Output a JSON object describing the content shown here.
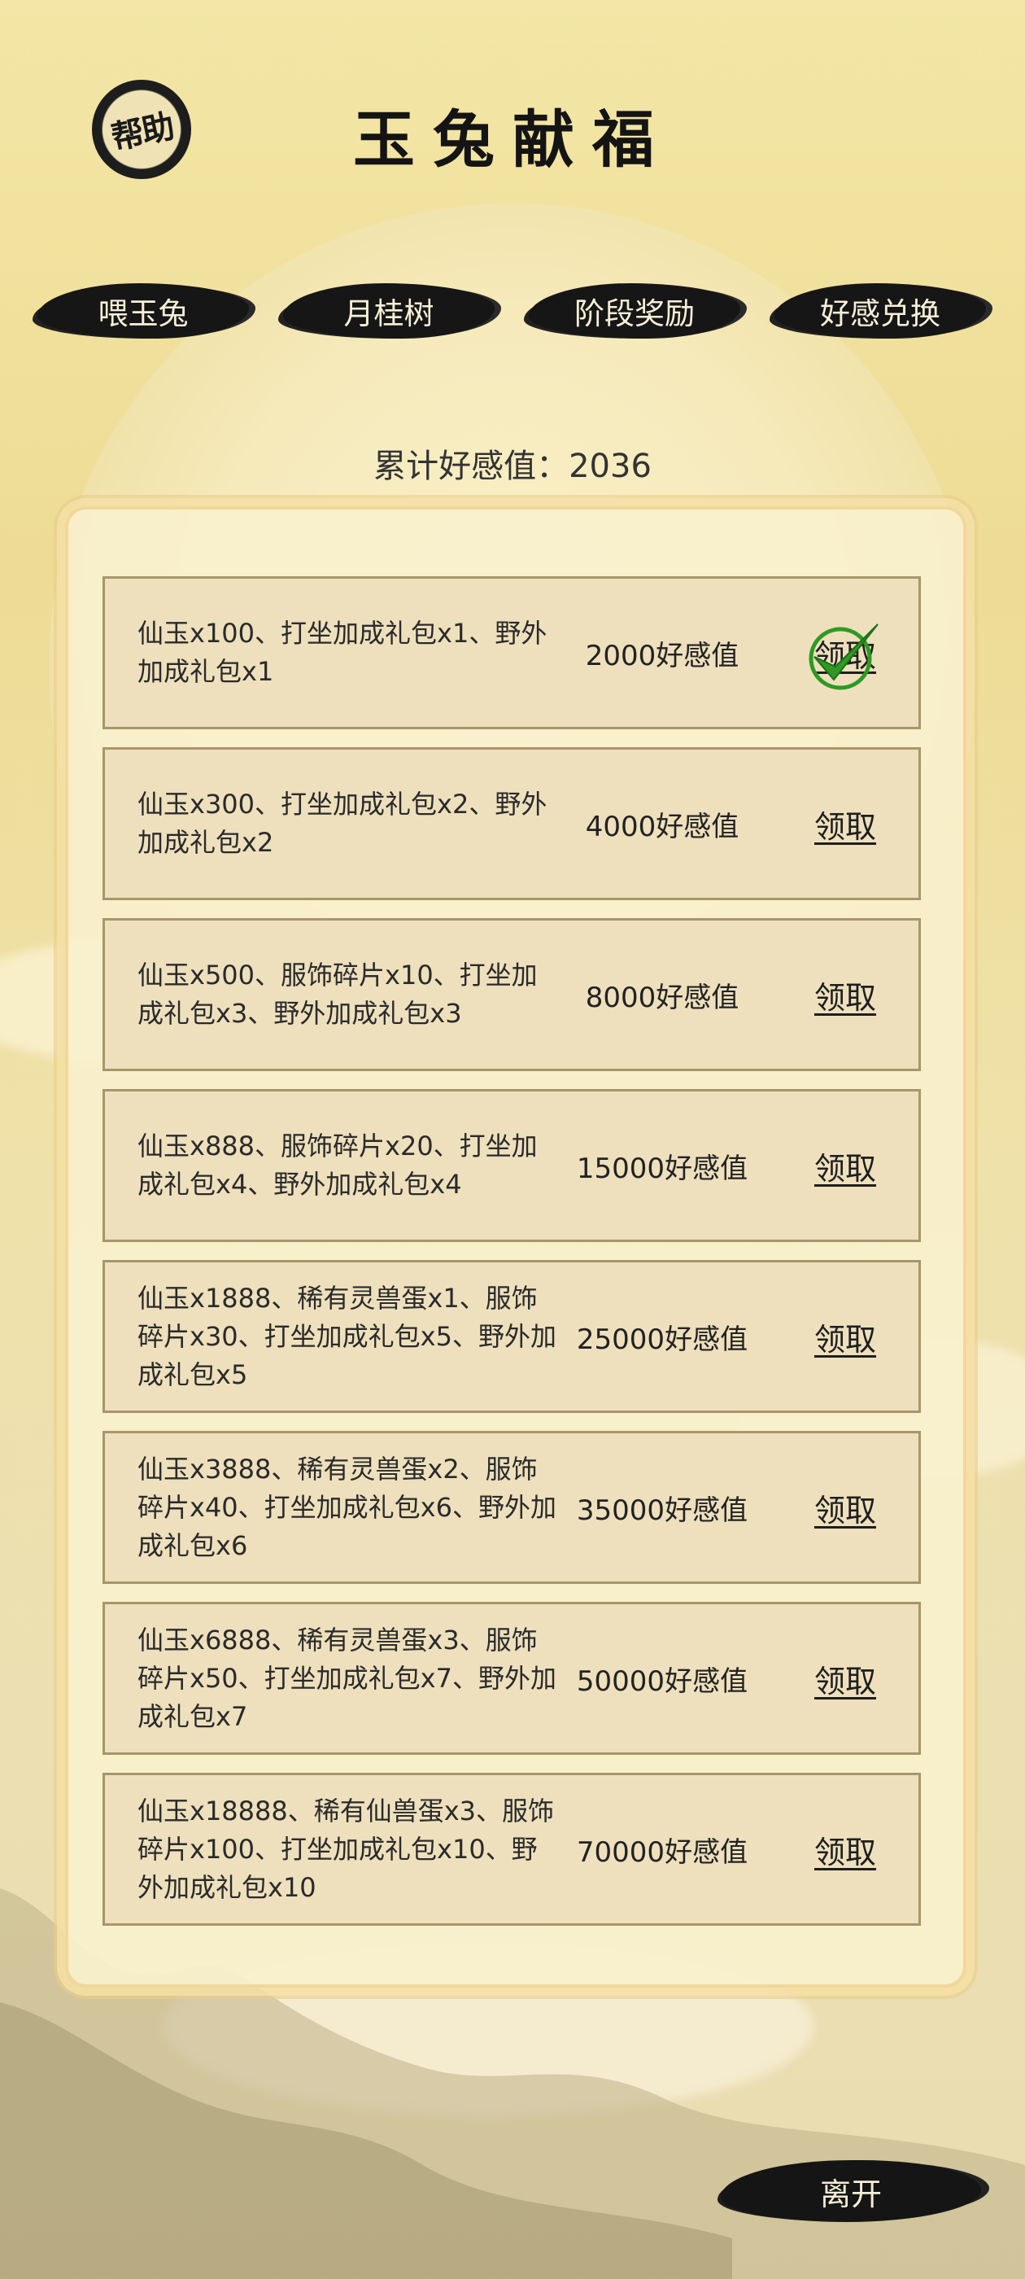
{
  "header": {
    "help_label": "帮助",
    "title": "玉兔献福"
  },
  "tabs": [
    {
      "label": "喂玉兔"
    },
    {
      "label": "月桂树"
    },
    {
      "label": "阶段奖励"
    },
    {
      "label": "好感兑换"
    }
  ],
  "total_favor": "累计好感值：2036",
  "rows": [
    {
      "reward": "仙玉x100、打坐加成礼包x1、野外加成礼包x1",
      "required": "2000好感值",
      "action": "领取",
      "claimed": true
    },
    {
      "reward": "仙玉x300、打坐加成礼包x2、野外加成礼包x2",
      "required": "4000好感值",
      "action": "领取",
      "claimed": false
    },
    {
      "reward": "仙玉x500、服饰碎片x10、打坐加成礼包x3、野外加成礼包x3",
      "required": "8000好感值",
      "action": "领取",
      "claimed": false
    },
    {
      "reward": "仙玉x888、服饰碎片x20、打坐加成礼包x4、野外加成礼包x4",
      "required": "15000好感值",
      "action": "领取",
      "claimed": false
    },
    {
      "reward": "仙玉x1888、稀有灵兽蛋x1、服饰碎片x30、打坐加成礼包x5、野外加成礼包x5",
      "required": "25000好感值",
      "action": "领取",
      "claimed": false
    },
    {
      "reward": "仙玉x3888、稀有灵兽蛋x2、服饰碎片x40、打坐加成礼包x6、野外加成礼包x6",
      "required": "35000好感值",
      "action": "领取",
      "claimed": false
    },
    {
      "reward": "仙玉x6888、稀有灵兽蛋x3、服饰碎片x50、打坐加成礼包x7、野外加成礼包x7",
      "required": "50000好感值",
      "action": "领取",
      "claimed": false
    },
    {
      "reward": "仙玉x18888、稀有仙兽蛋x3、服饰碎片x100、打坐加成礼包x10、野外加成礼包x10",
      "required": "70000好感值",
      "action": "领取",
      "claimed": false
    }
  ],
  "footer": {
    "leave_label": "离开"
  },
  "icons": {
    "claimed": "checkmark-icon"
  },
  "colors": {
    "ink": "#161616",
    "row_bg": "#eee0bd",
    "row_border": "#a6976a",
    "check": "#2e9a24"
  }
}
